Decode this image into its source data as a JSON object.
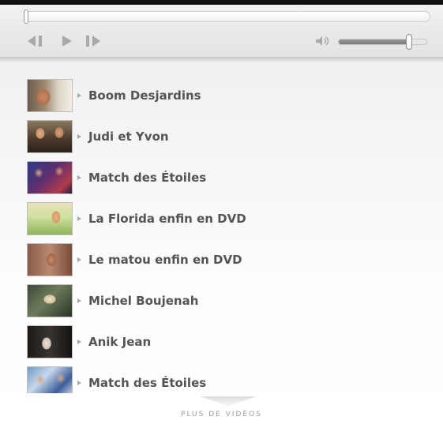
{
  "player": {
    "progress": 0,
    "volume": 0.8,
    "controls": [
      "previous-icon",
      "play-icon",
      "next-icon",
      "volume-icon"
    ]
  },
  "playlist": {
    "items": [
      {
        "title": "Boom Desjardins"
      },
      {
        "title": "Judi et Yvon"
      },
      {
        "title": "Match des Étoiles"
      },
      {
        "title": "La Florida enfin en DVD"
      },
      {
        "title": "Le matou enfin en DVD"
      },
      {
        "title": "Michel Boujenah"
      },
      {
        "title": "Anik Jean"
      },
      {
        "title": "Match des Étoiles"
      }
    ]
  },
  "more": {
    "label": "PLUS DE VIDÉOS"
  },
  "colors": {
    "title_text": "#545454",
    "more_text": "#9a9a9a",
    "top_bar": "#111111"
  }
}
